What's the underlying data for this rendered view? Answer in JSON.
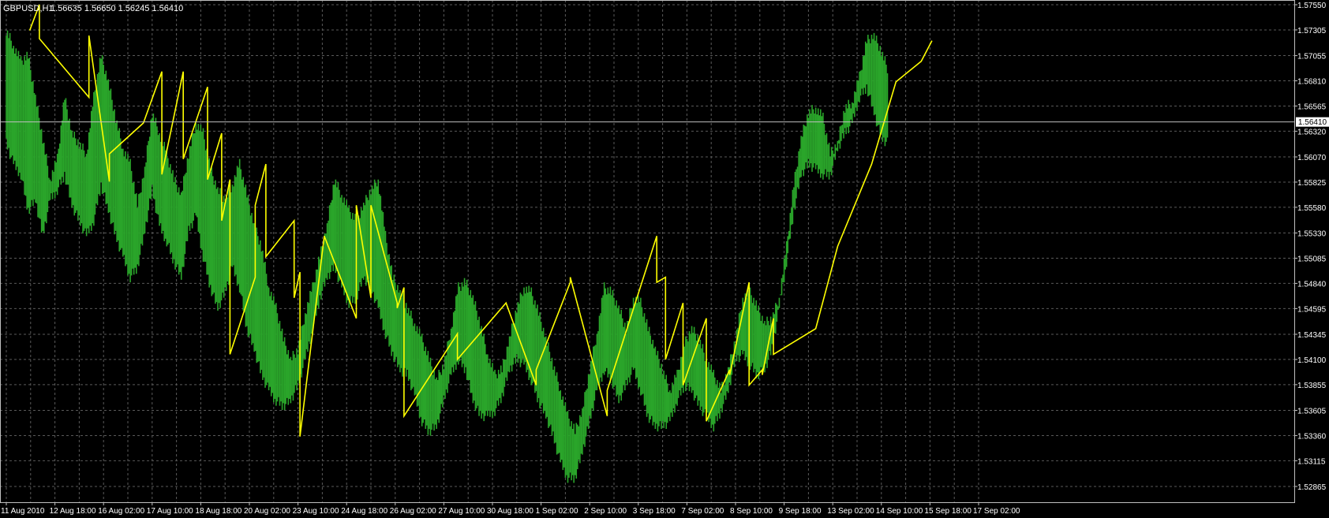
{
  "window": {
    "symbol_label": "GBPUSD,H1",
    "ohlc_label": "1.56635 1.56650 1.56245 1.56410"
  },
  "colors": {
    "background": "#000000",
    "grid": "#5a5a5a",
    "axis": "#c0c0c0",
    "text": "#ffffff",
    "candles": "#2aa52a",
    "indicator": "#ffff00",
    "bid_line": "#c0c0c0",
    "price_tag_bg": "#ffffff",
    "price_tag_text": "#000000"
  },
  "chart_data": {
    "type": "line",
    "price_axis": {
      "ticks": [
        "1.57550",
        "1.57305",
        "1.57055",
        "1.56810",
        "1.56565",
        "1.56320",
        "1.56070",
        "1.55825",
        "1.55580",
        "1.55330",
        "1.55085",
        "1.54840",
        "1.54595",
        "1.54345",
        "1.54100",
        "1.53855",
        "1.53605",
        "1.53360",
        "1.53115",
        "1.52865"
      ],
      "range": [
        1.52865,
        1.5755
      ],
      "current_price": "1.56410"
    },
    "time_axis": {
      "labels": [
        "11 Aug 2010",
        "12 Aug 18:00",
        "16 Aug 02:00",
        "17 Aug 10:00",
        "18 Aug 18:00",
        "20 Aug 02:00",
        "23 Aug 10:00",
        "24 Aug 18:00",
        "26 Aug 02:00",
        "27 Aug 10:00",
        "30 Aug 18:00",
        "1 Sep 02:00",
        "2 Sep 10:00",
        "3 Sep 18:00",
        "7 Sep 02:00",
        "8 Sep 10:00",
        "9 Sep 18:00",
        "13 Sep 02:00",
        "14 Sep 10:00",
        "15 Sep 18:00",
        "17 Sep 02:00"
      ],
      "range_index": [
        0,
        20
      ]
    },
    "series": [
      {
        "kind": "bars",
        "x": [
          0,
          0.15,
          0.3,
          0.45,
          0.6,
          0.75,
          0.9,
          1.05,
          1.2,
          1.35,
          1.5,
          1.65,
          1.8,
          1.95,
          2.1,
          2.25,
          2.4,
          2.55,
          2.7,
          2.85,
          3.0,
          3.15,
          3.3,
          3.45,
          3.6,
          3.75,
          3.9,
          4.05,
          4.2,
          4.35,
          4.5,
          4.65,
          4.8,
          4.95,
          5.1,
          5.25,
          5.4,
          5.55,
          5.7,
          5.85,
          6.0,
          6.15,
          6.3,
          6.45,
          6.6,
          6.75,
          6.9,
          7.05,
          7.2,
          7.35,
          7.5,
          7.65,
          7.8,
          7.95,
          8.1,
          8.25,
          8.4,
          8.55,
          8.7,
          8.85,
          9.0,
          9.15,
          9.3,
          9.45,
          9.6,
          9.75,
          9.9,
          10.05,
          10.2,
          10.35,
          10.5,
          10.65,
          10.8,
          10.95,
          11.1,
          11.25,
          11.4,
          11.55,
          11.7,
          11.85,
          12.0,
          12.15,
          12.3,
          12.45,
          12.6,
          12.75,
          12.9,
          13.05,
          13.2,
          13.35,
          13.5,
          13.65,
          13.8,
          13.95,
          14.1,
          14.25,
          14.4,
          14.55,
          14.7,
          14.85,
          15.0,
          15.15,
          15.3,
          15.45,
          15.6,
          15.75,
          15.9,
          16.05,
          16.2,
          16.35,
          16.5,
          16.65,
          16.8,
          16.95,
          17.1,
          17.25,
          17.4,
          17.55,
          17.7,
          17.85,
          18.0,
          18.15,
          18.3,
          18.45,
          18.6,
          18.75,
          18.9,
          19.05,
          19.2,
          19.35,
          19.5,
          19.65,
          19.8,
          19.95,
          20.1
        ],
        "high": [
          1.573,
          1.5715,
          1.57,
          1.5705,
          1.5665,
          1.5625,
          1.5585,
          1.5605,
          1.5665,
          1.563,
          1.562,
          1.561,
          1.5665,
          1.5705,
          1.568,
          1.5645,
          1.5615,
          1.56,
          1.556,
          1.5595,
          1.565,
          1.563,
          1.561,
          1.5585,
          1.557,
          1.561,
          1.564,
          1.563,
          1.5595,
          1.5575,
          1.5565,
          1.558,
          1.56,
          1.557,
          1.554,
          1.552,
          1.548,
          1.546,
          1.543,
          1.541,
          1.542,
          1.5455,
          1.548,
          1.551,
          1.554,
          1.5585,
          1.557,
          1.5555,
          1.5545,
          1.556,
          1.5575,
          1.5585,
          1.553,
          1.549,
          1.5475,
          1.546,
          1.5445,
          1.543,
          1.541,
          1.539,
          1.5405,
          1.544,
          1.548,
          1.5485,
          1.547,
          1.5445,
          1.5415,
          1.5395,
          1.54,
          1.543,
          1.546,
          1.548,
          1.5475,
          1.5455,
          1.543,
          1.5405,
          1.538,
          1.5355,
          1.534,
          1.536,
          1.54,
          1.5435,
          1.548,
          1.5475,
          1.546,
          1.544,
          1.547,
          1.5465,
          1.544,
          1.542,
          1.54,
          1.538,
          1.5395,
          1.5425,
          1.544,
          1.543,
          1.541,
          1.5395,
          1.538,
          1.54,
          1.543,
          1.547,
          1.5475,
          1.546,
          1.5445,
          1.545,
          1.547,
          1.552,
          1.558,
          1.5625,
          1.565,
          1.5655,
          1.5645,
          1.561,
          1.562,
          1.5655,
          1.566,
          1.5685,
          1.572,
          1.5725,
          1.571,
          1.569
        ],
        "low": [
          1.562,
          1.56,
          1.559,
          1.5555,
          1.5565,
          1.553,
          1.5565,
          1.5575,
          1.559,
          1.556,
          1.5545,
          1.553,
          1.5545,
          1.558,
          1.5555,
          1.553,
          1.551,
          1.549,
          1.55,
          1.5535,
          1.5575,
          1.554,
          1.5525,
          1.5505,
          1.549,
          1.5535,
          1.555,
          1.551,
          1.548,
          1.546,
          1.5475,
          1.55,
          1.548,
          1.544,
          1.542,
          1.5395,
          1.538,
          1.537,
          1.5365,
          1.537,
          1.5385,
          1.541,
          1.544,
          1.547,
          1.549,
          1.55,
          1.548,
          1.5465,
          1.547,
          1.549,
          1.548,
          1.546,
          1.5435,
          1.5415,
          1.54,
          1.5395,
          1.5375,
          1.535,
          1.534,
          1.5345,
          1.537,
          1.5395,
          1.541,
          1.54,
          1.537,
          1.5355,
          1.5355,
          1.536,
          1.5375,
          1.54,
          1.541,
          1.5405,
          1.539,
          1.537,
          1.5355,
          1.5335,
          1.531,
          1.5295,
          1.5295,
          1.532,
          1.535,
          1.538,
          1.54,
          1.539,
          1.537,
          1.5385,
          1.54,
          1.538,
          1.5355,
          1.5345,
          1.5345,
          1.535,
          1.537,
          1.5385,
          1.538,
          1.5365,
          1.5355,
          1.5345,
          1.536,
          1.538,
          1.541,
          1.5415,
          1.5405,
          1.5395,
          1.54,
          1.542,
          1.546,
          1.5505,
          1.5555,
          1.559,
          1.56,
          1.5595,
          1.559,
          1.559,
          1.5615,
          1.563,
          1.564,
          1.5665,
          1.5675,
          1.565,
          1.5625,
          1.562
        ]
      },
      {
        "kind": "indicator",
        "x": [
          0.48,
          0.68,
          0.68,
          1.7,
          1.7,
          2.12,
          2.12,
          2.82,
          3.2,
          3.2,
          3.64,
          3.64,
          4.14,
          4.14,
          4.43,
          4.43,
          4.6,
          4.6,
          5.12,
          5.12,
          5.34,
          5.34,
          5.92,
          5.92,
          6.04,
          6.04,
          6.54,
          7.2,
          7.2,
          7.5,
          7.5,
          8.04,
          8.04,
          8.18,
          8.18,
          9.28,
          9.28,
          10.28,
          10.28,
          10.9,
          10.9,
          11.6,
          11.6,
          12.36,
          12.36,
          13.38,
          13.38,
          13.56,
          13.56,
          13.92,
          13.92,
          14.4,
          14.4,
          14.88,
          14.88,
          15.28,
          15.28,
          15.55,
          15.55,
          15.78,
          15.78,
          16.65,
          17.1,
          17.8,
          18.3,
          18.82,
          19.04
        ],
        "y": [
          1.573,
          1.5755,
          1.5722,
          1.5665,
          1.5725,
          1.5583,
          1.561,
          1.564,
          1.569,
          1.559,
          1.569,
          1.5605,
          1.5675,
          1.5585,
          1.563,
          1.5545,
          1.5585,
          1.5415,
          1.549,
          1.556,
          1.56,
          1.551,
          1.5545,
          1.547,
          1.5495,
          1.5335,
          1.553,
          1.545,
          1.556,
          1.547,
          1.556,
          1.5465,
          1.546,
          1.548,
          1.5355,
          1.5435,
          1.541,
          1.5465,
          1.5465,
          1.5385,
          1.54,
          1.5485,
          1.549,
          1.5355,
          1.538,
          1.553,
          1.5485,
          1.549,
          1.541,
          1.5465,
          1.5385,
          1.545,
          1.535,
          1.54,
          1.5395,
          1.5485,
          1.5385,
          1.54,
          1.5395,
          1.545,
          1.5415,
          1.544,
          1.552,
          1.56,
          1.568,
          1.57,
          1.572
        ]
      }
    ]
  }
}
